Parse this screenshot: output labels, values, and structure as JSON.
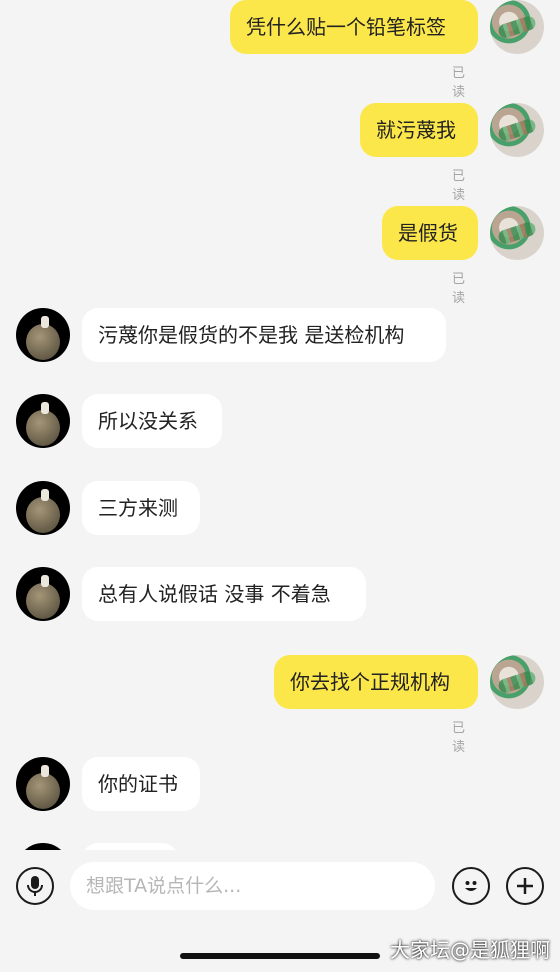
{
  "colors": {
    "background": "#f4f4f4",
    "my_bubble": "#fce74a",
    "other_bubble": "#ffffff",
    "read_text": "#a5a5a5"
  },
  "messages": [
    {
      "from": "me",
      "text": "凭什么贴一个铅笔标签",
      "read": "已读"
    },
    {
      "from": "me",
      "text": "就污蔑我",
      "read": "已读"
    },
    {
      "from": "me",
      "text": "是假货",
      "read": "已读"
    },
    {
      "from": "other",
      "text": "污蔑你是假货的不是我 是送检机构"
    },
    {
      "from": "other",
      "text": "所以没关系"
    },
    {
      "from": "other",
      "text": "三方来测"
    },
    {
      "from": "other",
      "text": "总有人说假话 没事 不着急"
    },
    {
      "from": "me",
      "text": "你去找个正规机构",
      "read": "已读"
    },
    {
      "from": "other",
      "text": "你的证书"
    }
  ],
  "input_bar": {
    "placeholder": "想跟TA说点什么...",
    "icons": [
      "microphone-icon",
      "emoji-icon",
      "plus-icon"
    ]
  },
  "watermark": "大家坛@是狐狸啊"
}
